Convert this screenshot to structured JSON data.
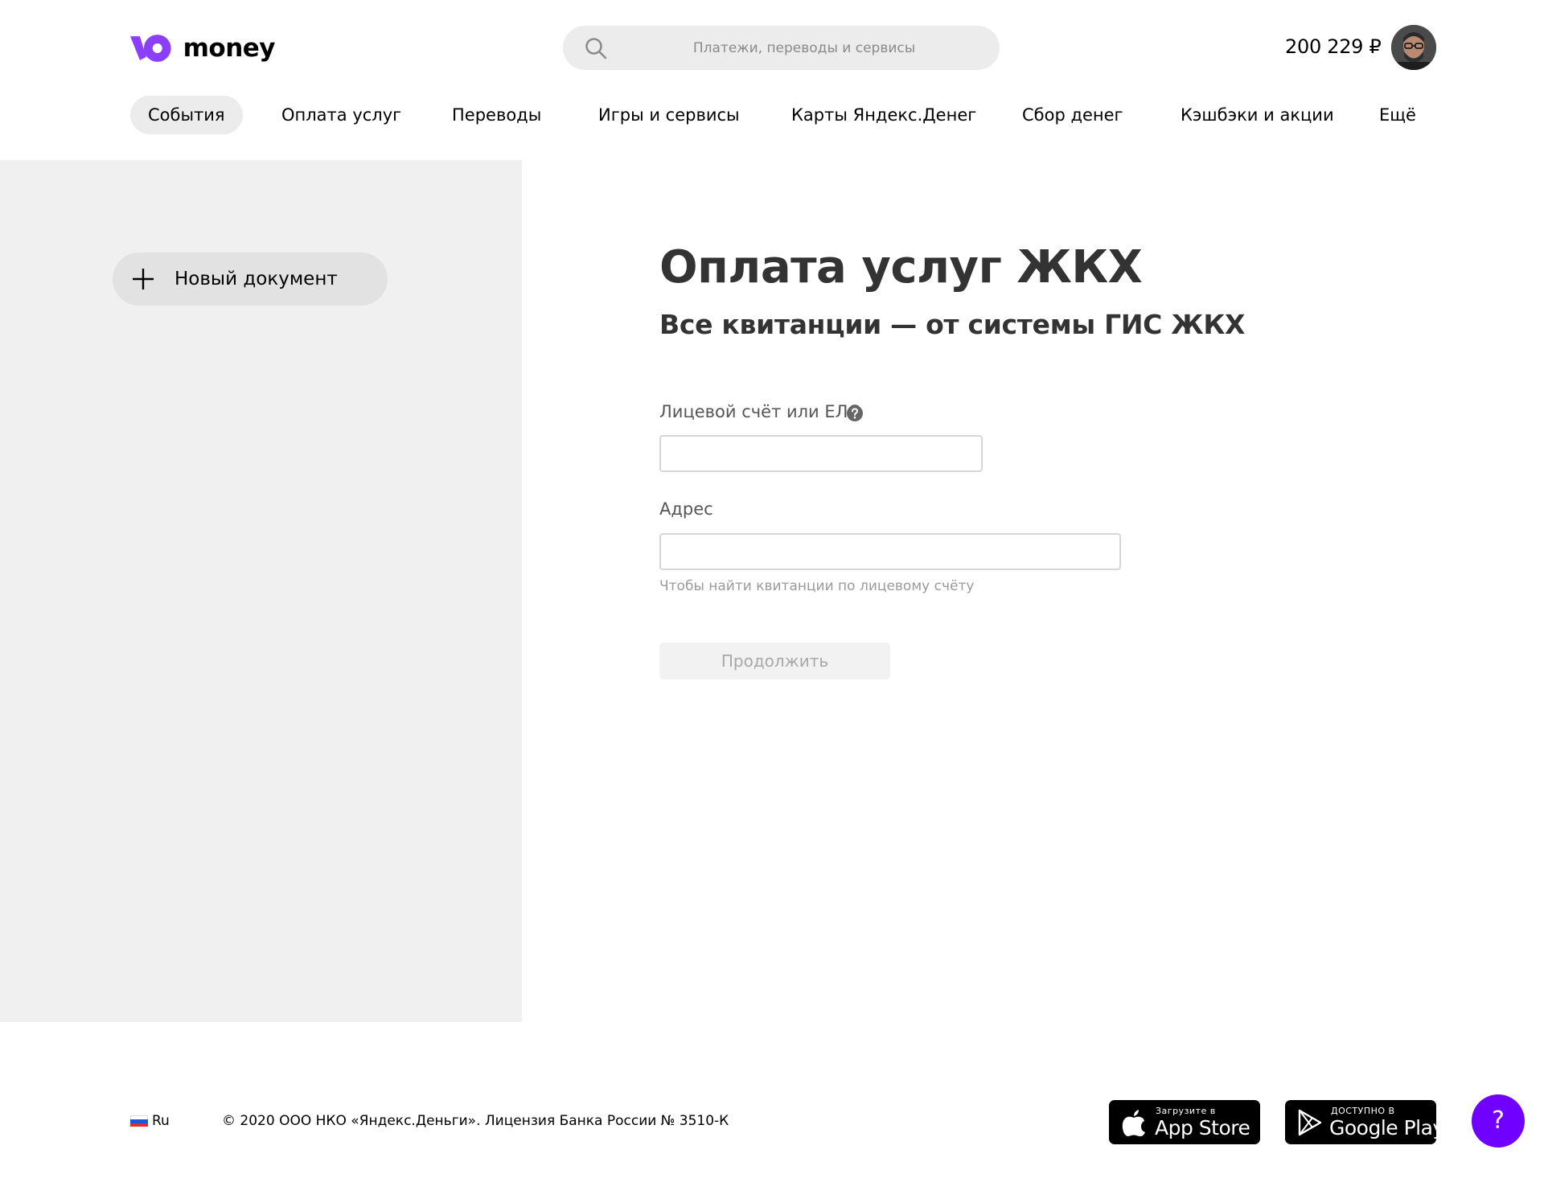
{
  "header": {
    "logo_text": "money",
    "search_placeholder": "Платежи, переводы и сервисы",
    "balance": "200 229 ₽"
  },
  "nav": {
    "items": [
      {
        "label": "События",
        "active": true
      },
      {
        "label": "Оплата услуг"
      },
      {
        "label": "Переводы"
      },
      {
        "label": "Игры и сервисы"
      },
      {
        "label": "Карты Яндекс.Денег"
      },
      {
        "label": "Сбор денег"
      },
      {
        "label": "Кэшбэки и акции"
      },
      {
        "label": "Ещё"
      }
    ]
  },
  "sidebar": {
    "new_document_label": "Новый документ"
  },
  "main": {
    "title": "Оплата услуг ЖКХ",
    "subtitle": "Все квитанции — от системы ГИС ЖКХ",
    "account_field": {
      "label": "Лицевой счёт или ЕЛС",
      "value": ""
    },
    "address_field": {
      "label": "Адрес",
      "value": "",
      "hint": "Чтобы найти квитанции по лицевому счёту"
    },
    "continue_label": "Продолжить"
  },
  "footer": {
    "language": "Ru",
    "copyright": "© 2020 ООО НКО «Яндекс.Деньги». Лицензия Банка России № 3510-К",
    "app_store": {
      "small": "Загрузите в",
      "big": "App Store"
    },
    "google_play": {
      "small": "ДОСТУПНО В",
      "big": "Google Play"
    },
    "help_label": "?"
  },
  "colors": {
    "brand": "#8b3ffd",
    "accent_fab": "#7000ff",
    "panel": "#f0f0f0",
    "pill": "#ececec"
  }
}
